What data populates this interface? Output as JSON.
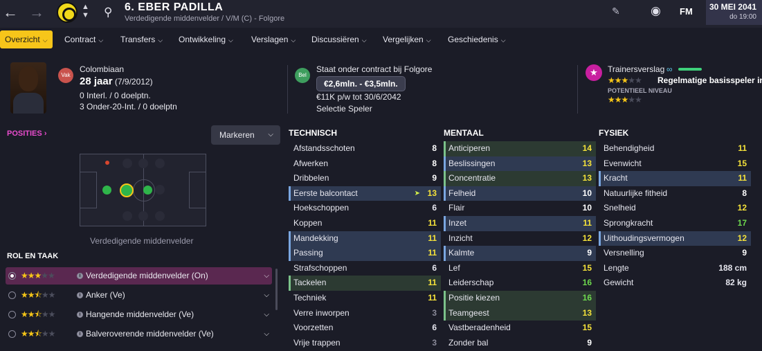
{
  "header": {
    "back_icon": "arrow-left-icon",
    "forward_icon": "arrow-right-icon",
    "player_name": "6. EBER PADILLA",
    "player_subtitle": "Verdedigende middenvelder / V/M (C) - Folgore",
    "date": "30 MEI 2041",
    "time": "do 19:00",
    "fm_label": "FM"
  },
  "tabs": [
    {
      "label": "Overzicht"
    },
    {
      "label": "Contract"
    },
    {
      "label": "Transfers"
    },
    {
      "label": "Ontwikkeling"
    },
    {
      "label": "Verslagen"
    },
    {
      "label": "Discussiëren"
    },
    {
      "label": "Vergelijken"
    },
    {
      "label": "Geschiedenis"
    }
  ],
  "bio": {
    "badge": "Vak",
    "nationality": "Colombiaan",
    "age": "28 jaar",
    "dob": "(7/9/2012)",
    "caps": "0 Interl. / 0 doelptn.",
    "youth_caps": "3 Onder-20-Int. / 0 doelptn"
  },
  "contract": {
    "badge": "Bel",
    "status": "Staat onder contract bij Folgore",
    "value_range": "€2,6mln. - €3,5mln.",
    "wage": "€11K p/w tot 30/6/2042",
    "selection": "Selectie Speler"
  },
  "coach_report": {
    "title": "Trainersverslag",
    "summary": "Regelmatige basisspeler in",
    "potential_label": "POTENTIEEL NIVEAU",
    "current_stars": 3,
    "potential_stars": 3
  },
  "positions": {
    "title": "POSITIES",
    "highlight_button": "Markeren",
    "description": "Verdedigende middenvelder"
  },
  "roles": {
    "title": "ROL EN TAAK",
    "items": [
      {
        "label": "Verdedigende middenvelder (On)",
        "stars": 3,
        "selected": true
      },
      {
        "label": "Anker (Ve)",
        "stars": 2.5,
        "selected": false
      },
      {
        "label": "Hangende middenvelder (Ve)",
        "stars": 2.5,
        "selected": false
      },
      {
        "label": "Balveroverende middenvelder (Ve)",
        "stars": 2.5,
        "selected": false
      }
    ]
  },
  "technical": {
    "title": "TECHNISCH",
    "rows": [
      {
        "name": "Afstandsschoten",
        "value": "8",
        "hl": ""
      },
      {
        "name": "Afwerken",
        "value": "8",
        "hl": ""
      },
      {
        "name": "Dribbelen",
        "value": "9",
        "hl": ""
      },
      {
        "name": "Eerste balcontact",
        "value": "13",
        "hl": "hl",
        "arrow": true
      },
      {
        "name": "Hoekschoppen",
        "value": "6",
        "hl": ""
      },
      {
        "name": "Koppen",
        "value": "11",
        "hl": ""
      },
      {
        "name": "Mandekking",
        "value": "11",
        "hl": "hl"
      },
      {
        "name": "Passing",
        "value": "11",
        "hl": "hl"
      },
      {
        "name": "Strafschoppen",
        "value": "6",
        "hl": ""
      },
      {
        "name": "Tackelen",
        "value": "11",
        "hl": "hg"
      },
      {
        "name": "Techniek",
        "value": "11",
        "hl": ""
      },
      {
        "name": "Verre inworpen",
        "value": "3",
        "hl": ""
      },
      {
        "name": "Voorzetten",
        "value": "6",
        "hl": ""
      },
      {
        "name": "Vrije trappen",
        "value": "3",
        "hl": ""
      }
    ]
  },
  "mental": {
    "title": "MENTAAL",
    "rows": [
      {
        "name": "Anticiperen",
        "value": "14",
        "hl": "hg"
      },
      {
        "name": "Beslissingen",
        "value": "13",
        "hl": "hl"
      },
      {
        "name": "Concentratie",
        "value": "13",
        "hl": "hg"
      },
      {
        "name": "Felheid",
        "value": "10",
        "hl": "hl"
      },
      {
        "name": "Flair",
        "value": "10",
        "hl": ""
      },
      {
        "name": "Inzet",
        "value": "11",
        "hl": "hl"
      },
      {
        "name": "Inzicht",
        "value": "12",
        "hl": ""
      },
      {
        "name": "Kalmte",
        "value": "9",
        "hl": "hl"
      },
      {
        "name": "Lef",
        "value": "15",
        "hl": ""
      },
      {
        "name": "Leiderschap",
        "value": "16",
        "hl": ""
      },
      {
        "name": "Positie kiezen",
        "value": "16",
        "hl": "hg"
      },
      {
        "name": "Teamgeest",
        "value": "13",
        "hl": "hg"
      },
      {
        "name": "Vastberadenheid",
        "value": "15",
        "hl": ""
      },
      {
        "name": "Zonder bal",
        "value": "9",
        "hl": ""
      }
    ]
  },
  "physical": {
    "title": "FYSIEK",
    "rows": [
      {
        "name": "Behendigheid",
        "value": "11",
        "hl": ""
      },
      {
        "name": "Evenwicht",
        "value": "15",
        "hl": ""
      },
      {
        "name": "Kracht",
        "value": "11",
        "hl": "hl"
      },
      {
        "name": "Natuurlijke fitheid",
        "value": "8",
        "hl": ""
      },
      {
        "name": "Snelheid",
        "value": "12",
        "hl": ""
      },
      {
        "name": "Sprongkracht",
        "value": "17",
        "hl": ""
      },
      {
        "name": "Uithoudingsvermogen",
        "value": "12",
        "hl": "hl"
      },
      {
        "name": "Versnelling",
        "value": "9",
        "hl": ""
      },
      {
        "name": "Lengte",
        "value": "188 cm",
        "hl": ""
      },
      {
        "name": "Gewicht",
        "value": "82 kg",
        "hl": ""
      }
    ]
  },
  "colors": {
    "accent": "#f7c51a",
    "magenta": "#e94ccd",
    "good": "#6ed84e",
    "ok": "#f5e23a"
  }
}
